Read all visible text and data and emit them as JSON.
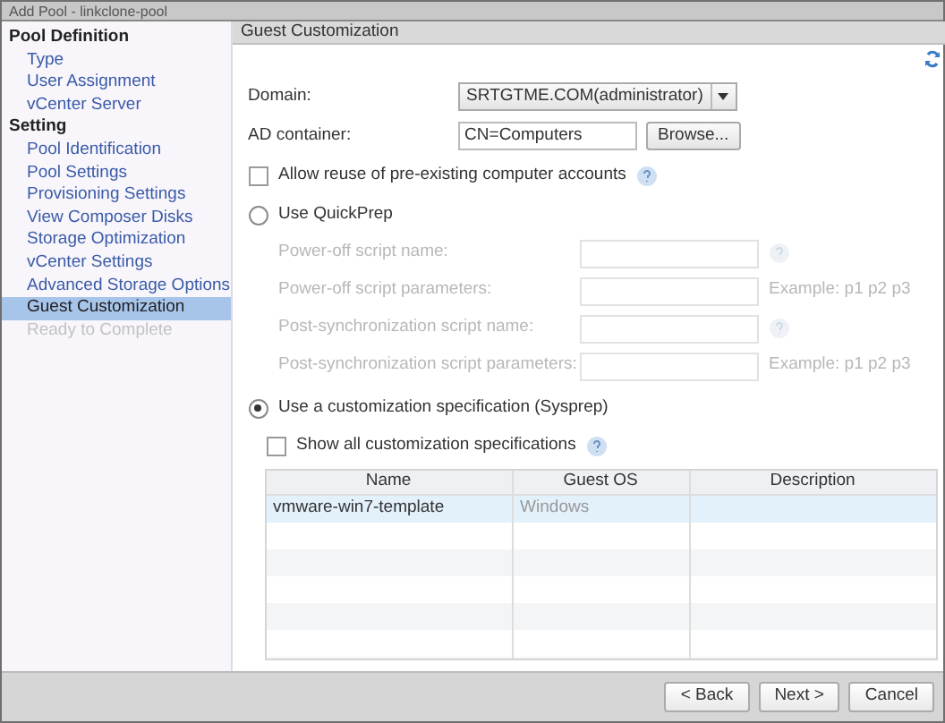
{
  "window": {
    "title": "Add Pool - linkclone-pool"
  },
  "sidebar": {
    "sections": [
      {
        "title": "Pool Definition",
        "items": [
          {
            "label": "Type",
            "selected": false,
            "disabled": false
          },
          {
            "label": "User Assignment",
            "selected": false,
            "disabled": false
          },
          {
            "label": "vCenter Server",
            "selected": false,
            "disabled": false
          }
        ]
      },
      {
        "title": "Setting",
        "items": [
          {
            "label": "Pool Identification",
            "selected": false,
            "disabled": false
          },
          {
            "label": "Pool Settings",
            "selected": false,
            "disabled": false
          },
          {
            "label": "Provisioning Settings",
            "selected": false,
            "disabled": false
          },
          {
            "label": "View Composer Disks",
            "selected": false,
            "disabled": false
          },
          {
            "label": "Storage Optimization",
            "selected": false,
            "disabled": false
          },
          {
            "label": "vCenter Settings",
            "selected": false,
            "disabled": false
          },
          {
            "label": "Advanced Storage Options",
            "selected": false,
            "disabled": false
          },
          {
            "label": "Guest Customization",
            "selected": true,
            "disabled": false
          },
          {
            "label": "Ready to Complete",
            "selected": false,
            "disabled": true
          }
        ]
      }
    ]
  },
  "panel": {
    "title": "Guest Customization",
    "domain": {
      "label": "Domain:",
      "value": "SRTGTME.COM(administrator)"
    },
    "ad_container": {
      "label": "AD container:",
      "value": "CN=Computers",
      "button": "Browse..."
    },
    "allow_reuse": {
      "label": "Allow reuse of pre-existing computer accounts",
      "checked": false
    },
    "quickprep": {
      "label": "Use QuickPrep",
      "selected": false,
      "fields": [
        {
          "label": "Power-off script name:",
          "kind": "help"
        },
        {
          "label": "Power-off script parameters:",
          "kind": "example",
          "example": "Example: p1 p2 p3"
        },
        {
          "label": "Post-synchronization script name:",
          "kind": "help"
        },
        {
          "label": "Post-synchronization script parameters:",
          "kind": "example",
          "example": "Example: p1 p2 p3"
        }
      ]
    },
    "sysprep": {
      "label": "Use a customization specification (Sysprep)",
      "selected": true
    },
    "show_all": {
      "label": "Show all customization specifications",
      "checked": false
    },
    "table": {
      "columns": [
        "Name",
        "Guest OS",
        "Description"
      ],
      "rows": [
        {
          "name": "vmware-win7-template",
          "guest_os": "Windows",
          "selected": true
        }
      ]
    }
  },
  "buttons": [
    "< Back",
    "Next >",
    "Cancel"
  ]
}
